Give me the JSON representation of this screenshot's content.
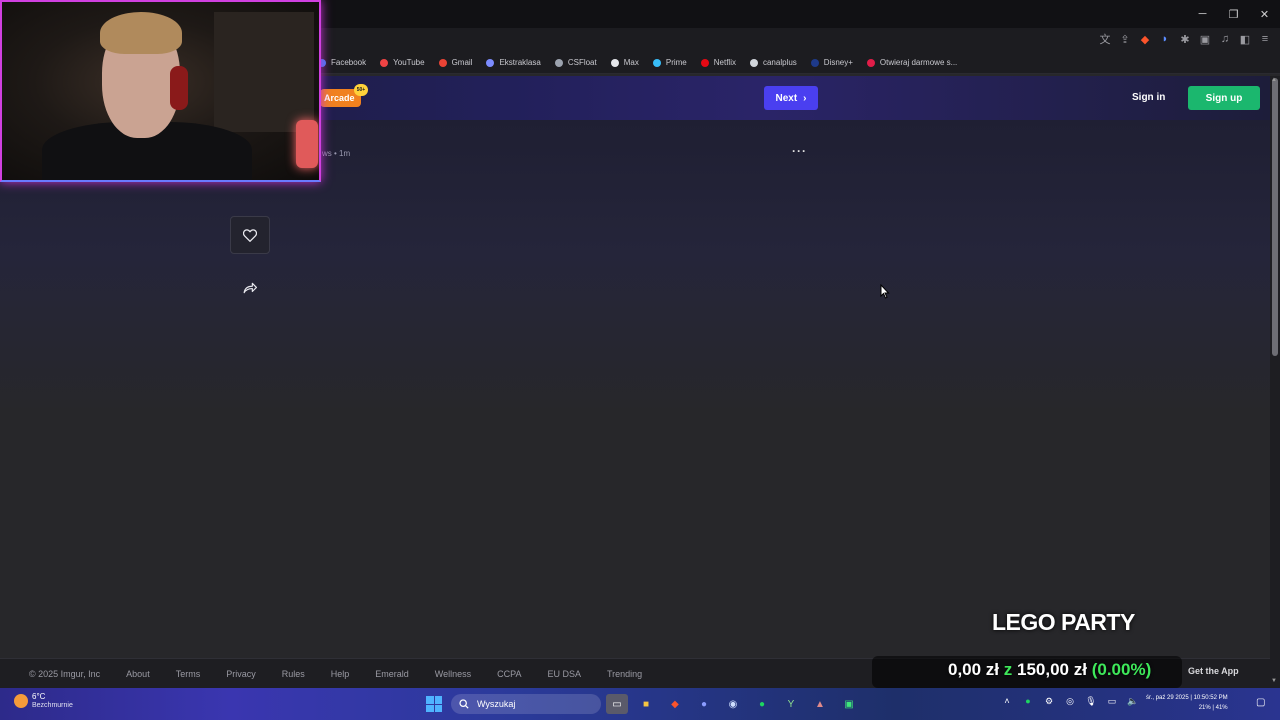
{
  "window": {
    "minimize": "─",
    "maximize": "❐",
    "close": "✕"
  },
  "toolbar": {
    "icons": [
      "translate-icon",
      "share-icon",
      "brave-shield-icon",
      "speech-icon",
      "extensions-icon",
      "tab-icon",
      "media-icon",
      "sidebar-icon",
      "menu-icon"
    ]
  },
  "bookmarks": [
    {
      "label": "Facebook",
      "color": "#3b82f6"
    },
    {
      "label": "YouTube",
      "color": "#ef4444"
    },
    {
      "label": "Gmail",
      "color": "#ea4335"
    },
    {
      "label": "Ekstraklasa",
      "color": "#7c8cff"
    },
    {
      "label": "CSFloat",
      "color": "#9ca3af"
    },
    {
      "label": "Max",
      "color": "#e5e7eb"
    },
    {
      "label": "Prime",
      "color": "#38bdf8"
    },
    {
      "label": "Netflix",
      "color": "#e50914"
    },
    {
      "label": "canalplus",
      "color": "#d1d5db"
    },
    {
      "label": "Disney+",
      "color": "#1e3a8a"
    },
    {
      "label": "Otwieraj darmowe s...",
      "color": "#e11d48"
    }
  ],
  "header": {
    "arcade_label": "Arcade",
    "arcade_badge": "50+",
    "next_label": "Next",
    "signin_label": "Sign in",
    "signup_label": "Sign up"
  },
  "post": {
    "meta": "ws • 1m",
    "more": "···"
  },
  "footer": {
    "links": [
      "© 2025 Imgur, Inc",
      "About",
      "Terms",
      "Privacy",
      "Rules",
      "Help",
      "Emerald",
      "Wellness",
      "CCPA",
      "EU DSA",
      "Trending"
    ],
    "get_app": "Get the App"
  },
  "overlay": {
    "game_title": "LEGO PARTY",
    "goal_current": "0,00 zł",
    "goal_sep": "z",
    "goal_target": "150,00 zł",
    "goal_percent": "(0.00%)"
  },
  "taskbar": {
    "weather_temp": "6°C",
    "weather_desc": "Bezchmurnie",
    "search_placeholder": "Wyszukaj",
    "clock_top": "śr., paź 29 2025 | 10:50:52 PM",
    "clock_bottom": "21% | 41%"
  },
  "colors": {
    "next": "#4a3ff0",
    "signup": "#1bb76e",
    "arcade": "#f0811f",
    "goal_percent": "#3ee85a",
    "webcam_border": "#d040e0"
  }
}
